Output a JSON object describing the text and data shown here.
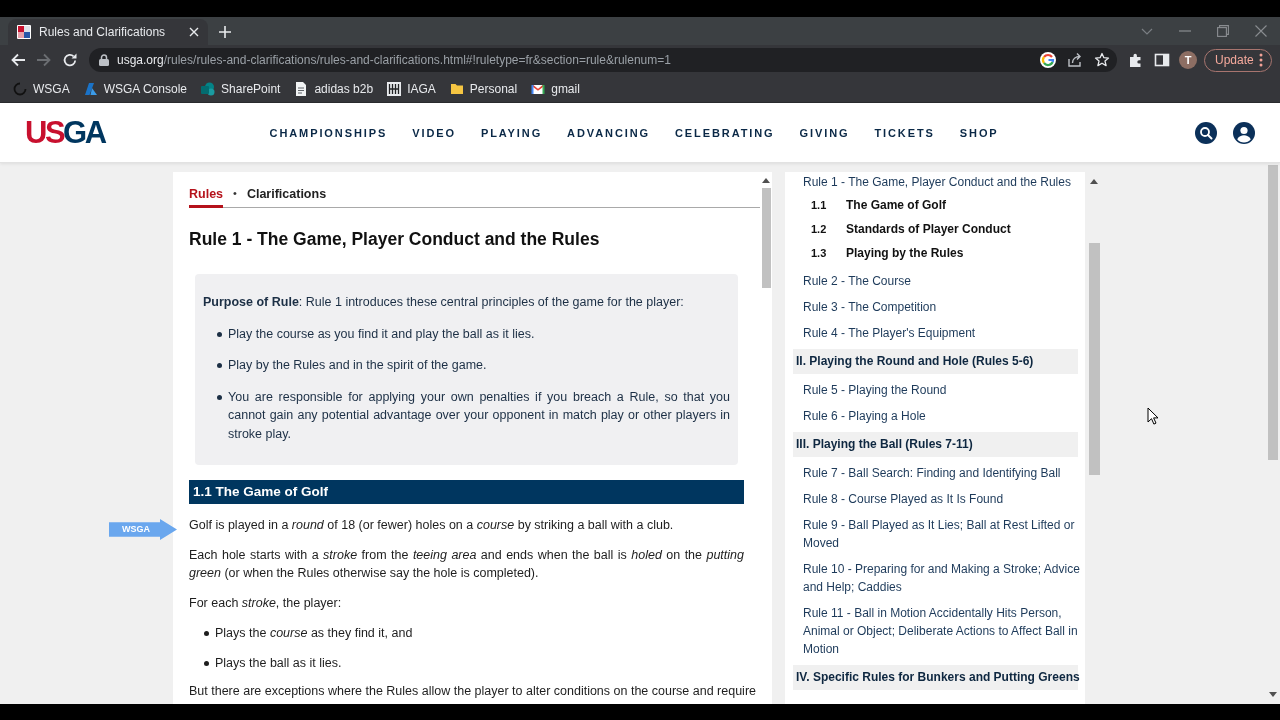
{
  "browser": {
    "tab_title": "Rules and Clarifications",
    "nav_buttons": [
      {
        "kind": "back",
        "disabled": false
      },
      {
        "kind": "forward",
        "disabled": true
      },
      {
        "kind": "reload",
        "disabled": false
      }
    ],
    "url": {
      "host": "usga.org",
      "path": "/rules/rules-and-clarifications/rules-and-clarifications.html#!ruletype=fr&section=rule&rulenum=1"
    },
    "profile_initial": "T",
    "update_label": "Update",
    "bookmarks": [
      {
        "label": "WSGA",
        "kind": "page"
      },
      {
        "label": "WSGA Console",
        "kind": "page"
      },
      {
        "label": "SharePoint",
        "kind": "page"
      },
      {
        "label": "adidas b2b",
        "kind": "page"
      },
      {
        "label": "IAGA",
        "kind": "page"
      },
      {
        "label": "Personal",
        "kind": "folder"
      },
      {
        "label": "gmail",
        "kind": "page"
      }
    ]
  },
  "site_header": {
    "logo": "USGA",
    "nav": [
      "CHAMPIONSHIPS",
      "VIDEO",
      "PLAYING",
      "ADVANCING",
      "CELEBRATING",
      "GIVING",
      "TICKETS",
      "SHOP"
    ]
  },
  "article": {
    "tabs": [
      {
        "label": "Rules",
        "selected": true
      },
      {
        "label": "Clarifications",
        "selected": false
      }
    ],
    "tab_separator": "•",
    "title": "Rule 1 - The Game, Player Conduct and the Rules",
    "purpose": {
      "text": "**Purpose of Rule**: Rule 1 introduces these central principles of the game for the player:",
      "points": [
        "Play the course as you find it and play the ball as it lies.",
        "Play by the Rules and in the spirit of the game.",
        "You are responsible for applying your own penalties if you breach a Rule, so that you cannot gain any potential advantage over your opponent in match play or other players in stroke play."
      ]
    },
    "sections": [
      {
        "heading": "1.1 The Game of Golf",
        "blocks": [
          {
            "kind": "paragraph",
            "text": "Golf is played in a *round* of 18 (or fewer) holes on a *course* by striking a ball with a club."
          },
          {
            "kind": "paragraph",
            "text": "Each hole starts with a *stroke* from the *teeing area* and ends when the ball is *holed* on the *putting green* (or when the Rules otherwise say the hole is completed)."
          },
          {
            "kind": "paragraph",
            "text": "For each *stroke*, the player:"
          },
          {
            "kind": "bullet",
            "text": "Plays the *course* as they find it, and"
          },
          {
            "kind": "bullet",
            "text": "Plays the ball as it lies."
          },
          {
            "kind": "paragraph",
            "text": "But there are exceptions where the Rules allow the player to alter conditions on the course and require"
          }
        ]
      }
    ]
  },
  "annotation": {
    "label": "WSGA"
  },
  "toc": {
    "groups": [
      {
        "rules": [
          {
            "label": "Rule 1 - The Game, Player Conduct and the Rules",
            "children": [
              {
                "number": "1.1",
                "label": "The Game of Golf"
              },
              {
                "number": "1.2",
                "label": "Standards of Player Conduct"
              },
              {
                "number": "1.3",
                "label": "Playing by the Rules"
              }
            ]
          },
          {
            "label": "Rule 2 - The Course"
          },
          {
            "label": "Rule 3 - The Competition"
          },
          {
            "label": "Rule 4 - The Player's Equipment"
          }
        ]
      },
      {
        "heading": "II. Playing the Round and Hole (Rules 5-6)",
        "rules": [
          {
            "label": "Rule 5 - Playing the Round"
          },
          {
            "label": "Rule 6 - Playing a Hole"
          }
        ]
      },
      {
        "heading": "III. Playing the Ball (Rules 7-11)",
        "rules": [
          {
            "label": "Rule 7 - Ball Search: Finding and Identifying Ball"
          },
          {
            "label": "Rule 8 - Course Played as It Is Found"
          },
          {
            "label": "Rule 9 - Ball Played as It Lies; Ball at Rest Lifted or Moved"
          },
          {
            "label": "Rule 10 - Preparing for and Making a Stroke; Advice and Help; Caddies"
          },
          {
            "label": "Rule 11 - Ball in Motion Accidentally Hits Person, Animal or Object; Deliberate Actions to Affect Ball in Motion"
          }
        ]
      },
      {
        "heading": "IV. Specific Rules for Bunkers and Putting Greens"
      }
    ]
  }
}
